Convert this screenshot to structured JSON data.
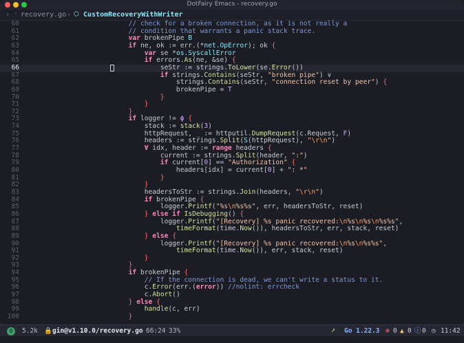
{
  "window": {
    "title": "DotFairy Emacs - recovery.go"
  },
  "header": {
    "file": "recovery.go",
    "function": "CustomRecoveryWithWriter"
  },
  "editor": {
    "current_line": "66",
    "lines": [
      {
        "n": "60",
        "tokens": [
          [
            "c",
            "                        // check for a broken connection, as it is not really a"
          ]
        ]
      },
      {
        "n": "61",
        "tokens": [
          [
            "c",
            "                        // condition that warrants a panic stack trace."
          ]
        ]
      },
      {
        "n": "62",
        "tokens": [
          [
            "o",
            "                        "
          ],
          [
            "k",
            "var"
          ],
          [
            "o",
            " brokenPipe "
          ],
          [
            "t",
            "B"
          ]
        ]
      },
      {
        "n": "63",
        "tokens": [
          [
            "o",
            "                        "
          ],
          [
            "k",
            "if"
          ],
          [
            "o",
            " ne, ok := err.("
          ],
          [
            "o",
            "*"
          ],
          [
            "t",
            "net.OpError"
          ],
          [
            "o",
            "); ok "
          ],
          [
            "p",
            "{"
          ]
        ]
      },
      {
        "n": "64",
        "tokens": [
          [
            "o",
            "                            "
          ],
          [
            "k",
            "var"
          ],
          [
            "o",
            " se "
          ],
          [
            "o",
            "*"
          ],
          [
            "t",
            "os.SyscallError"
          ]
        ]
      },
      {
        "n": "65",
        "tokens": [
          [
            "o",
            "                            "
          ],
          [
            "k",
            "if"
          ],
          [
            "o",
            " errors."
          ],
          [
            "f",
            "As"
          ],
          [
            "o",
            "(ne, &se) "
          ],
          [
            "p",
            "{"
          ]
        ]
      },
      {
        "n": "66",
        "tokens": [
          [
            "o",
            "                                seStr := strings."
          ],
          [
            "f",
            "ToLower"
          ],
          [
            "o",
            "(se."
          ],
          [
            "f",
            "Error"
          ],
          [
            "o",
            "())"
          ]
        ]
      },
      {
        "n": "67",
        "tokens": [
          [
            "o",
            "                                "
          ],
          [
            "k",
            "if"
          ],
          [
            "o",
            " strings."
          ],
          [
            "f",
            "Contains"
          ],
          [
            "o",
            "(seStr, "
          ],
          [
            "s",
            "\"broken pipe\""
          ],
          [
            "o",
            ") ∨"
          ]
        ]
      },
      {
        "n": "68",
        "tokens": [
          [
            "o",
            "                                    strings."
          ],
          [
            "f",
            "Contains"
          ],
          [
            "o",
            "(seStr, "
          ],
          [
            "s",
            "\"connection reset by peer\""
          ],
          [
            "o",
            ") "
          ],
          [
            "p",
            "{"
          ]
        ]
      },
      {
        "n": "69",
        "tokens": [
          [
            "o",
            "                                    brokenPipe = "
          ],
          [
            "n",
            "T"
          ]
        ]
      },
      {
        "n": "70",
        "tokens": [
          [
            "o",
            "                                "
          ],
          [
            "p",
            "}"
          ]
        ]
      },
      {
        "n": "71",
        "tokens": [
          [
            "o",
            "                            "
          ],
          [
            "p",
            "}"
          ]
        ]
      },
      {
        "n": "72",
        "tokens": [
          [
            "o",
            "                        "
          ],
          [
            "p",
            "}"
          ]
        ]
      },
      {
        "n": "73",
        "tokens": [
          [
            "o",
            "                        "
          ],
          [
            "k",
            "if"
          ],
          [
            "o",
            " logger != "
          ],
          [
            "n",
            "ϕ"
          ],
          [
            "o",
            " "
          ],
          [
            "p",
            "{"
          ]
        ]
      },
      {
        "n": "74",
        "tokens": [
          [
            "o",
            "                            stack := "
          ],
          [
            "f",
            "stack"
          ],
          [
            "o",
            "("
          ],
          [
            "n",
            "3"
          ],
          [
            "o",
            ")"
          ]
        ]
      },
      {
        "n": "75",
        "tokens": [
          [
            "o",
            "                            httpRequest, _ := httputil."
          ],
          [
            "f",
            "DumpRequest"
          ],
          [
            "o",
            "(c.Request, "
          ],
          [
            "n",
            "F"
          ],
          [
            "o",
            ")"
          ]
        ]
      },
      {
        "n": "76",
        "tokens": [
          [
            "o",
            "                            headers := strings."
          ],
          [
            "f",
            "Split"
          ],
          [
            "o",
            "("
          ],
          [
            "t",
            "S"
          ],
          [
            "o",
            "(httpRequest), "
          ],
          [
            "s",
            "\""
          ],
          [
            "e",
            "\\r\\n"
          ],
          [
            "s",
            "\""
          ],
          [
            "o",
            ")"
          ]
        ]
      },
      {
        "n": "77",
        "tokens": [
          [
            "o",
            "                            "
          ],
          [
            "k",
            "∀"
          ],
          [
            "o",
            " idx, header := "
          ],
          [
            "k",
            "range"
          ],
          [
            "o",
            " headers "
          ],
          [
            "p",
            "{"
          ]
        ]
      },
      {
        "n": "78",
        "tokens": [
          [
            "o",
            "                                current := strings."
          ],
          [
            "f",
            "Split"
          ],
          [
            "o",
            "(header, "
          ],
          [
            "s",
            "\":\""
          ],
          [
            "o",
            ")"
          ]
        ]
      },
      {
        "n": "79",
        "tokens": [
          [
            "o",
            "                                "
          ],
          [
            "k",
            "if"
          ],
          [
            "o",
            " current["
          ],
          [
            "n",
            "0"
          ],
          [
            "o",
            "] == "
          ],
          [
            "s",
            "\"Authorization\""
          ],
          [
            "o",
            " "
          ],
          [
            "p",
            "{"
          ]
        ]
      },
      {
        "n": "80",
        "tokens": [
          [
            "o",
            "                                    headers[idx] = current["
          ],
          [
            "n",
            "0"
          ],
          [
            "o",
            "] + "
          ],
          [
            "s",
            "\": *\""
          ]
        ]
      },
      {
        "n": "81",
        "tokens": [
          [
            "o",
            "                                "
          ],
          [
            "p",
            "}"
          ]
        ]
      },
      {
        "n": "82",
        "tokens": [
          [
            "o",
            "                            "
          ],
          [
            "p",
            "}"
          ]
        ]
      },
      {
        "n": "83",
        "tokens": [
          [
            "o",
            "                            headersToStr := strings."
          ],
          [
            "f",
            "Join"
          ],
          [
            "o",
            "(headers, "
          ],
          [
            "s",
            "\""
          ],
          [
            "e",
            "\\r\\n"
          ],
          [
            "s",
            "\""
          ],
          [
            "o",
            ")"
          ]
        ]
      },
      {
        "n": "84",
        "tokens": [
          [
            "o",
            "                            "
          ],
          [
            "k",
            "if"
          ],
          [
            "o",
            " brokenPipe "
          ],
          [
            "p",
            "{"
          ]
        ]
      },
      {
        "n": "85",
        "tokens": [
          [
            "o",
            "                                logger."
          ],
          [
            "f",
            "Printf"
          ],
          [
            "o",
            "("
          ],
          [
            "s",
            "\"%s"
          ],
          [
            "e",
            "\\n"
          ],
          [
            "s",
            "%s%s\""
          ],
          [
            "o",
            ", err, headersToStr, reset)"
          ]
        ]
      },
      {
        "n": "86",
        "tokens": [
          [
            "o",
            "                            "
          ],
          [
            "p",
            "}"
          ],
          [
            "o",
            " "
          ],
          [
            "k",
            "else if"
          ],
          [
            "o",
            " "
          ],
          [
            "f",
            "IsDebugging"
          ],
          [
            "o",
            "() "
          ],
          [
            "p",
            "{"
          ]
        ]
      },
      {
        "n": "87",
        "tokens": [
          [
            "o",
            "                                logger."
          ],
          [
            "f",
            "Printf"
          ],
          [
            "o",
            "("
          ],
          [
            "s",
            "\"[Recovery] %s panic recovered:"
          ],
          [
            "e",
            "\\n"
          ],
          [
            "s",
            "%s"
          ],
          [
            "e",
            "\\n"
          ],
          [
            "s",
            "%s"
          ],
          [
            "e",
            "\\n"
          ],
          [
            "s",
            "%s%s\""
          ],
          [
            "o",
            ","
          ]
        ]
      },
      {
        "n": "88",
        "tokens": [
          [
            "o",
            "                                    "
          ],
          [
            "f",
            "timeFormat"
          ],
          [
            "o",
            "(time."
          ],
          [
            "f",
            "Now"
          ],
          [
            "o",
            "()), headersToStr, err, stack, reset)"
          ]
        ]
      },
      {
        "n": "89",
        "tokens": [
          [
            "o",
            "                            "
          ],
          [
            "p",
            "}"
          ],
          [
            "o",
            " "
          ],
          [
            "k",
            "else"
          ],
          [
            "o",
            " "
          ],
          [
            "p",
            "{"
          ]
        ]
      },
      {
        "n": "90",
        "tokens": [
          [
            "o",
            "                                logger."
          ],
          [
            "f",
            "Printf"
          ],
          [
            "o",
            "("
          ],
          [
            "s",
            "\"[Recovery] %s panic recovered:"
          ],
          [
            "e",
            "\\n"
          ],
          [
            "s",
            "%s"
          ],
          [
            "e",
            "\\n"
          ],
          [
            "s",
            "%s%s\""
          ],
          [
            "o",
            ","
          ]
        ]
      },
      {
        "n": "91",
        "tokens": [
          [
            "o",
            "                                    "
          ],
          [
            "f",
            "timeFormat"
          ],
          [
            "o",
            "(time."
          ],
          [
            "f",
            "Now"
          ],
          [
            "o",
            "()), err, stack, reset)"
          ]
        ]
      },
      {
        "n": "92",
        "tokens": [
          [
            "o",
            "                            "
          ],
          [
            "p",
            "}"
          ]
        ]
      },
      {
        "n": "93",
        "tokens": [
          [
            "o",
            "                        "
          ],
          [
            "p",
            "}"
          ]
        ]
      },
      {
        "n": "94",
        "tokens": [
          [
            "o",
            "                        "
          ],
          [
            "k",
            "if"
          ],
          [
            "o",
            " brokenPipe "
          ],
          [
            "p",
            "{"
          ]
        ]
      },
      {
        "n": "95",
        "tokens": [
          [
            "c",
            "                            // If the connection is dead, we can't write a status to it."
          ]
        ]
      },
      {
        "n": "96",
        "tokens": [
          [
            "o",
            "                            c."
          ],
          [
            "f",
            "Error"
          ],
          [
            "o",
            "(err.("
          ],
          [
            "k",
            "error"
          ],
          [
            "o",
            ")) "
          ],
          [
            "c",
            "//nolint: errcheck"
          ]
        ]
      },
      {
        "n": "97",
        "tokens": [
          [
            "o",
            "                            c."
          ],
          [
            "f",
            "Abort"
          ],
          [
            "o",
            "()"
          ]
        ]
      },
      {
        "n": "98",
        "tokens": [
          [
            "o",
            "                        "
          ],
          [
            "p",
            "}"
          ],
          [
            "o",
            " "
          ],
          [
            "k",
            "else"
          ],
          [
            "o",
            " "
          ],
          [
            "p",
            "{"
          ]
        ]
      },
      {
        "n": "99",
        "tokens": [
          [
            "o",
            "                            "
          ],
          [
            "f",
            "handle"
          ],
          [
            "o",
            "(c, err)"
          ]
        ]
      },
      {
        "n": "100",
        "tokens": [
          [
            "o",
            "                        "
          ],
          [
            "p",
            "}"
          ]
        ]
      }
    ]
  },
  "modeline": {
    "window_number": "0",
    "file_size": "5.2k",
    "buffer_path": "gin@v1.10.0/recovery.go",
    "position": "66:24",
    "percent": "33%",
    "language": "Go 1.22.3",
    "errors": "0",
    "warnings": "0",
    "infos": "0",
    "clock": "11:42"
  }
}
